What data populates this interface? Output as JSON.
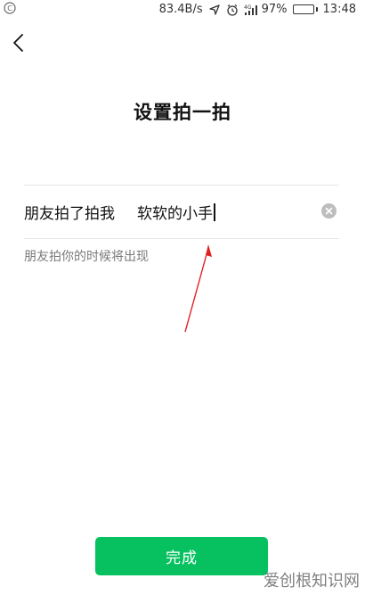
{
  "status_bar": {
    "network_speed": "83.4B/s",
    "network_type": "4G",
    "battery_percent": "97%",
    "battery_level": 0.97,
    "time": "13:48",
    "icons": [
      "app-notification-icon",
      "location-icon",
      "alarm-icon",
      "signal-icon",
      "battery-icon"
    ]
  },
  "header": {
    "back_icon": "chevron-left-icon"
  },
  "main": {
    "title": "设置拍一拍",
    "prefix_label": "朋友拍了拍我",
    "suffix_value": "软软的小手",
    "hint": "朋友拍你的时候将出现"
  },
  "footer": {
    "done_label": "完成"
  },
  "watermark": {
    "text": "爱创根知识网"
  },
  "colors": {
    "accent_green": "#07c160",
    "annotation_red": "#e02020"
  }
}
